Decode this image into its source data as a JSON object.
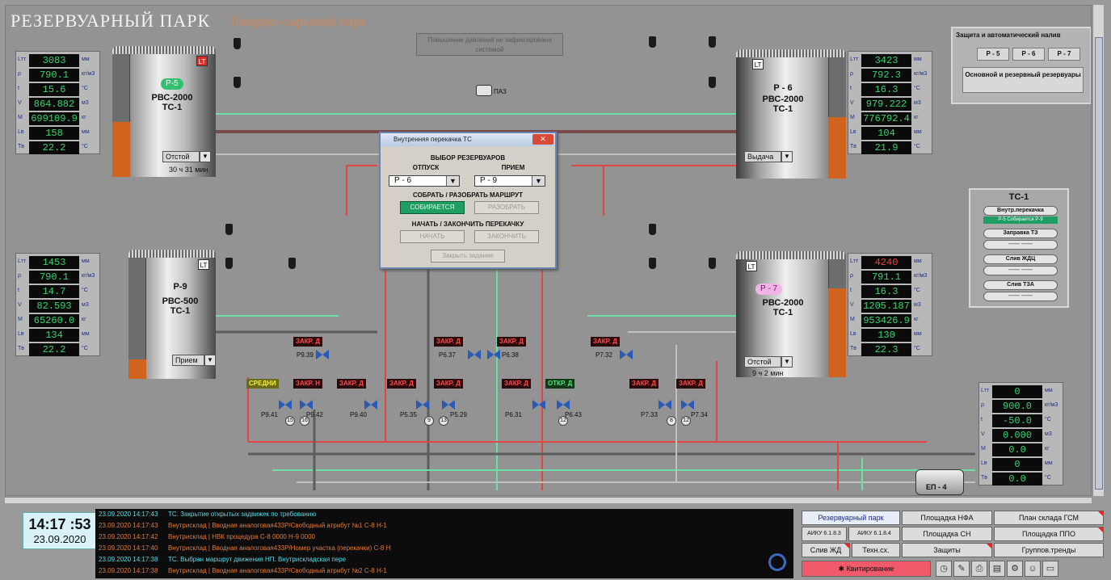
{
  "header": {
    "title": "РЕЗЕРВУАРНЫЙ ПАРК",
    "subtitle": "Товарно-сырьевой парк"
  },
  "status_box": "Повышение давления не зафиксировано системой",
  "pump_label": "ПАЗ",
  "tanks": {
    "p5": {
      "pill": "Р-5",
      "type": "РВС-2000",
      "group": "ТС-1",
      "mode": "Отстой",
      "timer": "30 ч 31 мин",
      "lt": "LT"
    },
    "p6": {
      "name": "Р - 6",
      "type": "РВС-2000",
      "group": "ТС-1",
      "mode": "Выдача",
      "lt": "LT"
    },
    "p9": {
      "name": "Р-9",
      "type": "РВС-500",
      "group": "ТС-1",
      "mode": "Прием",
      "lt": "LT"
    },
    "p7": {
      "pill": "Р - 7",
      "type": "РВС-2000",
      "group": "ТС-1",
      "mode": "Отстой",
      "timer": "9 ч 2 мин",
      "lt": "LT"
    }
  },
  "readouts": {
    "p5": [
      {
        "lbl": "Lтт",
        "val": "3083",
        "unit": "мм"
      },
      {
        "lbl": "ρ",
        "val": "790.1",
        "unit": "кг/м3"
      },
      {
        "lbl": "t",
        "val": "15.6",
        "unit": "°C"
      },
      {
        "lbl": "V",
        "val": "864.882",
        "unit": "м3"
      },
      {
        "lbl": "M",
        "val": "699109.9",
        "unit": "кг"
      },
      {
        "lbl": "Lв",
        "val": "158",
        "unit": "мм"
      },
      {
        "lbl": "Tв",
        "val": "22.2",
        "unit": "°C"
      }
    ],
    "p6": [
      {
        "lbl": "Lтт",
        "val": "3423",
        "unit": "мм"
      },
      {
        "lbl": "ρ",
        "val": "792.3",
        "unit": "кг/м3"
      },
      {
        "lbl": "t",
        "val": "16.3",
        "unit": "°C"
      },
      {
        "lbl": "V",
        "val": "979.222",
        "unit": "м3"
      },
      {
        "lbl": "M",
        "val": "776792.4",
        "unit": "кг"
      },
      {
        "lbl": "Lв",
        "val": "104",
        "unit": "мм"
      },
      {
        "lbl": "Tв",
        "val": "21.9",
        "unit": "°C"
      }
    ],
    "p9": [
      {
        "lbl": "Lтт",
        "val": "1453",
        "unit": "мм"
      },
      {
        "lbl": "ρ",
        "val": "790.1",
        "unit": "кг/м3"
      },
      {
        "lbl": "t",
        "val": "14.7",
        "unit": "°C"
      },
      {
        "lbl": "V",
        "val": "82.593",
        "unit": "м3"
      },
      {
        "lbl": "M",
        "val": "65260.0",
        "unit": "кг"
      },
      {
        "lbl": "Lв",
        "val": "134",
        "unit": "мм"
      },
      {
        "lbl": "Tв",
        "val": "22.2",
        "unit": "°C"
      }
    ],
    "p7": [
      {
        "lbl": "Lтт",
        "val": "4240",
        "unit": "мм",
        "red": true
      },
      {
        "lbl": "ρ",
        "val": "791.1",
        "unit": "кг/м3"
      },
      {
        "lbl": "t",
        "val": "16.3",
        "unit": "°C"
      },
      {
        "lbl": "V",
        "val": "1205.187",
        "unit": "м3"
      },
      {
        "lbl": "M",
        "val": "953426.9",
        "unit": "кг"
      },
      {
        "lbl": "Lв",
        "val": "130",
        "unit": "мм"
      },
      {
        "lbl": "Tв",
        "val": "22.3",
        "unit": "°C"
      }
    ],
    "tz": [
      {
        "lbl": "Lтт",
        "val": "0",
        "unit": "мм"
      },
      {
        "lbl": "ρ",
        "val": "900.0",
        "unit": "кг/м3"
      },
      {
        "lbl": "t",
        "val": "-50.0",
        "unit": "°C"
      },
      {
        "lbl": "V",
        "val": "0.000",
        "unit": "м3"
      },
      {
        "lbl": "M",
        "val": "0.0",
        "unit": "кг"
      },
      {
        "lbl": "Lв",
        "val": "0",
        "unit": "мм"
      },
      {
        "lbl": "Tв",
        "val": "0.0",
        "unit": "°C"
      }
    ]
  },
  "dialog": {
    "title": "Внутренняя перекачка ТС",
    "close": "✕",
    "header": "ВЫБОР РЕЗЕРВУАРОВ",
    "from_label": "ОТПУСК",
    "to_label": "ПРИЕМ",
    "from_value": "Р - 6",
    "to_value": "Р - 9",
    "route_header": "СОБРАТЬ / РАЗОБРАТЬ МАРШРУТ",
    "collecting_btn": "СОБИРАЕТСЯ",
    "disassemble_btn": "РАЗОБРАТЬ",
    "transfer_header": "НАЧАТЬ / ЗАКОНЧИТЬ ПЕРЕКАЧКУ",
    "start_btn": "НАЧАТЬ",
    "finish_btn": "ЗАКОНЧИТЬ",
    "close_btn": "Закрыть задание"
  },
  "protection": {
    "title": "Защита и автоматический налив",
    "buttons": [
      "Р - 5",
      "Р - 6",
      "Р - 7"
    ],
    "main_btn": "Основной и резервный резервуары"
  },
  "tc_panel": {
    "title": "ТС-1",
    "internal": "Внутр.перекачка",
    "status": "Р-5 Собирается Р-9",
    "tz": "Заправка ТЗ",
    "zhdc": "Слив ЖДЦ",
    "tza": "Слив ТЗА",
    "dashes": "——  ——"
  },
  "valves": [
    {
      "id": "p941",
      "label": "Р9.41",
      "tag": "СРЕДНИ",
      "tagcolor": "yellow",
      "num": "15"
    },
    {
      "id": "p942",
      "label": "Р9.42",
      "tag": "ЗАКР. Н",
      "tagcolor": "red",
      "num": "16"
    },
    {
      "id": "p940",
      "label": "Р9.40",
      "tag": "ЗАКР. Д",
      "tagcolor": "red"
    },
    {
      "id": "p5",
      "label": "Р5.35",
      "tag": "ЗАКР. Д",
      "tagcolor": "red",
      "num": "9"
    },
    {
      "id": "p529",
      "label": "Р5.29",
      "tag": "ЗАКР. Д",
      "tagcolor": "red",
      "num": "13"
    },
    {
      "id": "p631",
      "label": "Р6.31",
      "tag": "ЗАКР. Д",
      "tagcolor": "red"
    },
    {
      "id": "p643",
      "label": "Р6.43",
      "tag": "ОТКР. Д",
      "tagcolor": "green",
      "num": "12"
    },
    {
      "id": "p733",
      "label": "Р7.33",
      "tag": "ЗАКР. Д",
      "tagcolor": "red",
      "num": "8"
    },
    {
      "id": "p734",
      "label": "Р7.34",
      "tag": "ЗАКР. Д",
      "tagcolor": "red",
      "num": "12"
    },
    {
      "id": "p939",
      "label": "Р9.39",
      "tag": "ЗАКР. Д",
      "tagcolor": "red"
    },
    {
      "id": "p637",
      "label": "Р6.37",
      "tag": "ЗАКР. Д",
      "tagcolor": "red"
    },
    {
      "id": "p638",
      "label": "Р6.38",
      "tag": "ЗАКР. Д",
      "tagcolor": "red"
    },
    {
      "id": "p732",
      "label": "Р7.32",
      "tag": "ЗАКР. Д",
      "tagcolor": "red"
    }
  ],
  "pump_tz": "ЕП - 4",
  "clock": {
    "time": "14:17 :53",
    "date": "23.09.2020"
  },
  "log": [
    {
      "ts": "23.09.2020 14:17:43",
      "text": "ТС. Закрытие открытых задвижек по требованию",
      "color": "cyan"
    },
    {
      "ts": "23.09.2020 14:17:43",
      "text": "Внутрисклад | Вводная аналоговая433Р/Свободный атрибут №1 С-8 Н-1",
      "color": "orange"
    },
    {
      "ts": "23.09.2020 14:17:42",
      "text": "Внутрисклад | НВК процедура С-8 0000 Н-9 0000",
      "color": "orange"
    },
    {
      "ts": "23.09.2020 14:17:40",
      "text": "Внутрисклад | Вводная аналоговая433Р/Номер участка (перекачки) С-8 Н",
      "color": "orange"
    },
    {
      "ts": "23.09.2020 14:17:38",
      "text": "ТС. Выбран маршрут движения НП. Внутрискладская пере",
      "color": "cyan"
    },
    {
      "ts": "23.09.2020 14:17:38",
      "text": "Внутрисклад | Вводная аналоговая433Р/Свободный атрибут №2 С-8 Н-1",
      "color": "orange"
    }
  ],
  "nav": {
    "r1": [
      "Резервуарный парк",
      "Площадка НФА",
      "План склада ГСМ"
    ],
    "r2a": [
      "АИКУ 6.1.8.3",
      "АИКУ 6.1.8.4"
    ],
    "r2b": [
      "Площадка СН",
      "Площадка ППО"
    ],
    "r3": [
      "Слив ЖД",
      "Техн.сх.",
      "Защиты",
      "Группов.тренды"
    ],
    "ack": "Квитирование"
  }
}
